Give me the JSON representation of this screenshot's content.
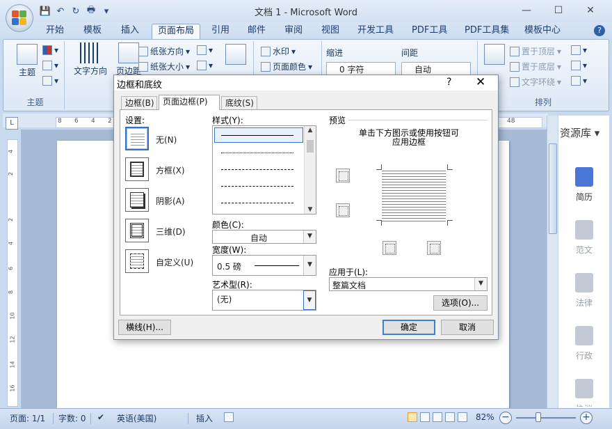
{
  "window": {
    "title": "文档 1 - Microsoft Word",
    "minimize": "—",
    "maximize": "☐",
    "close": "✕"
  },
  "qat": {
    "save": "💾",
    "undo": "↶",
    "repeat": "↻",
    "print": "🖶",
    "more": "▾"
  },
  "ribbon_tabs": [
    "开始",
    "模板",
    "插入",
    "页面布局",
    "引用",
    "邮件",
    "审阅",
    "视图",
    "开发工具",
    "PDF工具",
    "PDF工具集",
    "模板中心"
  ],
  "active_tab": "页面布局",
  "help": "?",
  "ribbon": {
    "theme_label": "主题",
    "theme_group": "主题",
    "text_direction": "文字方向",
    "page_margin_partial": "页边距",
    "paper_direction": "纸张方向",
    "paper_size": "纸张大小",
    "watermark": "水印",
    "page_color": "页面颜色",
    "indent_label": "缩进",
    "indent_value": "0 字符",
    "spacing_label": "间距",
    "spacing_value": "自动",
    "bring_front": "置于顶层",
    "send_back": "置于底层",
    "text_wrap": "文字环绕",
    "arrange_group": "排列"
  },
  "ruler_numbers": [
    "8",
    "6",
    "4",
    "2",
    "48"
  ],
  "vruler_numbers": [
    "4",
    "2",
    "2",
    "4",
    "6",
    "8",
    "10",
    "12",
    "14",
    "16"
  ],
  "resource_panel": {
    "title": "资源库",
    "items": [
      {
        "label": "简历",
        "state": "active"
      },
      {
        "label": "范文",
        "state": "inactive"
      },
      {
        "label": "法律",
        "state": "inactive"
      },
      {
        "label": "行政",
        "state": "inactive"
      },
      {
        "label": "协议",
        "state": "inactive"
      }
    ]
  },
  "status": {
    "page": "页面: 1/1",
    "words": "字数: 0",
    "language": "英语(美国)",
    "insert": "插入",
    "zoom": "82%",
    "zoom_minus": "−",
    "zoom_plus": "+"
  },
  "dialog": {
    "title": "边框和底纹",
    "help": "?",
    "close": "✕",
    "tabs": [
      "边框(B)",
      "页面边框(P)",
      "底纹(S)"
    ],
    "active_tab": "页面边框(P)",
    "settings_label": "设置:",
    "settings": [
      {
        "label": "无(N)",
        "selected": true
      },
      {
        "label": "方框(X)",
        "selected": false
      },
      {
        "label": "阴影(A)",
        "selected": false
      },
      {
        "label": "三维(D)",
        "selected": false
      },
      {
        "label": "自定义(U)",
        "selected": false
      }
    ],
    "style_label": "样式(Y):",
    "color_label": "颜色(C):",
    "color_value": "自动",
    "width_label": "宽度(W):",
    "width_value": "0.5 磅",
    "art_label": "艺术型(R):",
    "art_value": "(无)",
    "preview_label": "预览",
    "preview_hint_1": "单击下方图示或使用按钮可",
    "preview_hint_2": "应用边框",
    "apply_label": "应用于(L):",
    "apply_value": "整篇文档",
    "options_button": "选项(O)...",
    "hline_button": "横线(H)...",
    "ok_button": "确定",
    "cancel_button": "取消"
  }
}
